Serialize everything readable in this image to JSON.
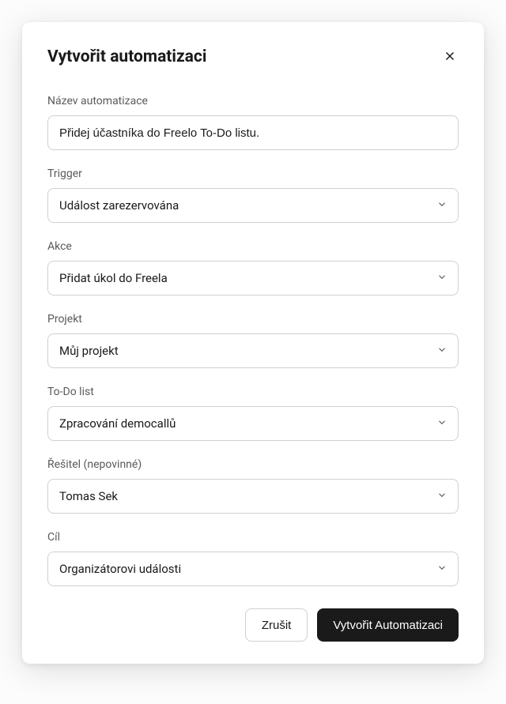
{
  "modal": {
    "title": "Vytvořit automatizaci",
    "fields": {
      "name": {
        "label": "Název automatizace",
        "value": "Přidej účastníka do Freelo To-Do listu."
      },
      "trigger": {
        "label": "Trigger",
        "value": "Událost zarezervována"
      },
      "action": {
        "label": "Akce",
        "value": "Přidat úkol do Freela"
      },
      "project": {
        "label": "Projekt",
        "value": "Můj projekt"
      },
      "todolist": {
        "label": "To-Do list",
        "value": "Zpracování democallů"
      },
      "assignee": {
        "label": "Řešitel (nepovinné)",
        "value": "Tomas Sek"
      },
      "target": {
        "label": "Cíl",
        "value": "Organizátorovi události"
      }
    },
    "buttons": {
      "cancel": "Zrušit",
      "submit": "Vytvořit Automatizaci"
    }
  }
}
